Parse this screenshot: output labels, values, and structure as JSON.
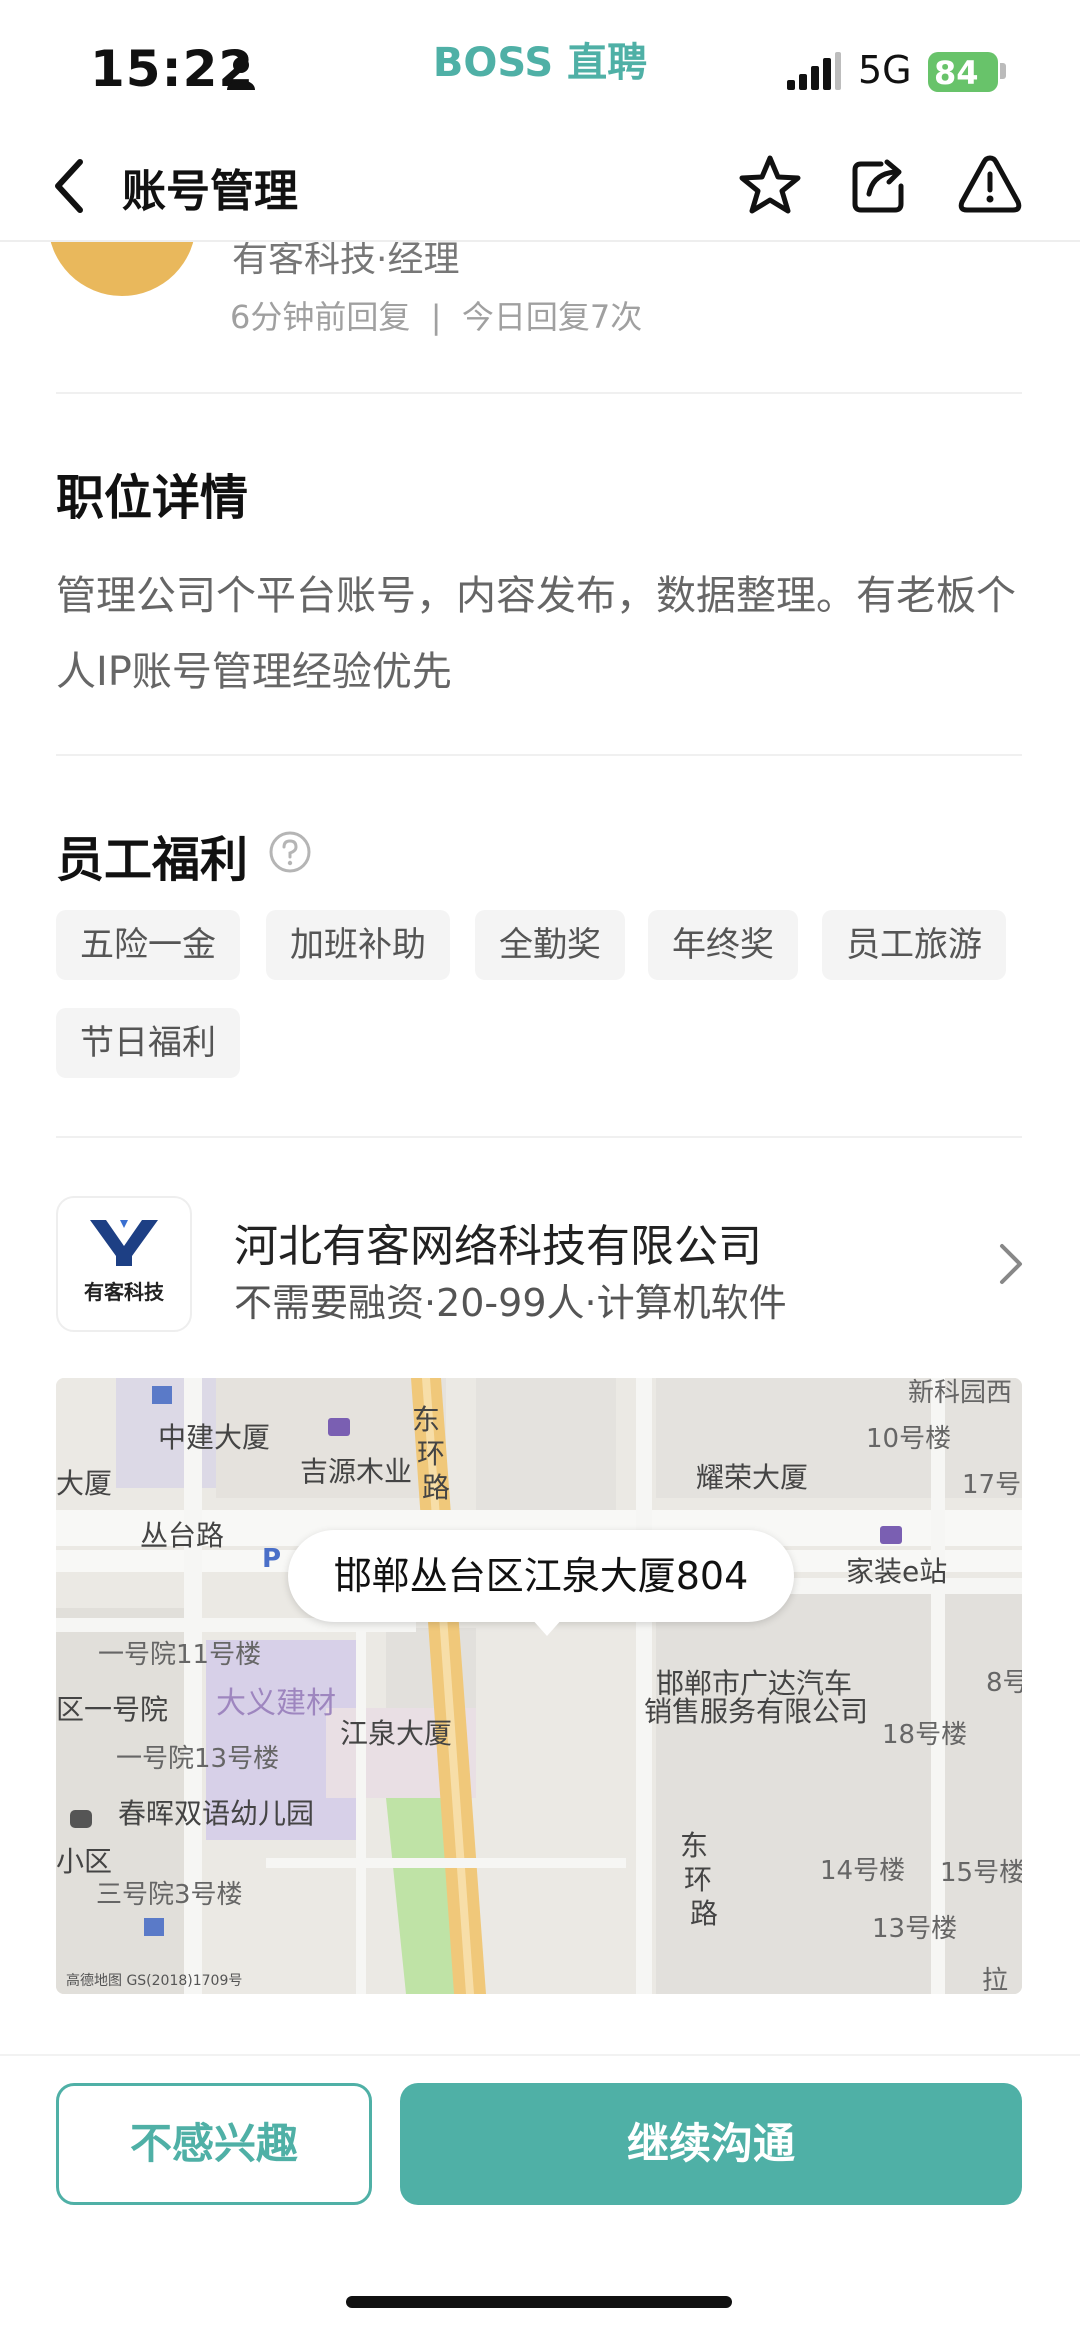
{
  "status_bar": {
    "time": "15:22",
    "app_brand": "BOSS 直聘",
    "network": "5G",
    "battery": "84"
  },
  "nav": {
    "title": "账号管理",
    "icons": [
      "back-icon",
      "star-icon",
      "share-icon",
      "warning-icon"
    ]
  },
  "recruiter": {
    "title": "有客科技·经理",
    "reply_info": "6分钟前回复  |  今日回复7次"
  },
  "job_details": {
    "heading": "职位详情",
    "description": "管理公司个平台账号，内容发布，数据整理。有老板个人IP账号管理经验优先"
  },
  "benefits": {
    "heading": "员工福利",
    "items": [
      "五险一金",
      "加班补助",
      "全勤奖",
      "年终奖",
      "员工旅游",
      "节日福利"
    ]
  },
  "company": {
    "logo_text": "有客科技",
    "name": "河北有客网络科技有限公司",
    "meta": "不需要融资·20-99人·计算机软件"
  },
  "map": {
    "address": "邯郸丛台区江泉大厦804",
    "labels": {
      "zhongjian": "中建大厦",
      "jiyuan": "吉源木业",
      "dong1": "东",
      "huan1": "环",
      "lu1": "路",
      "yaorong": "耀荣大厦",
      "xinke": "新科园西",
      "lou10": "10号楼",
      "lou17": "17号",
      "jiazhuang": "家装e站",
      "dasha_left": "大厦",
      "congtai": "丛台路",
      "p": "P",
      "yihaoyuan11": "一号院11号楼",
      "dayi": "大义建材",
      "jiangquan": "江泉大厦",
      "guangda1": "邯郸市广达汽车",
      "guangda2": "销售服务有限公司",
      "lou8": "8号",
      "qu_yihaoyuan": "区一号院",
      "yihaoyuan13": "一号院13号楼",
      "lou18": "18号楼",
      "chunhui": "春晖双语幼儿园",
      "dong2": "东",
      "huan2": "环",
      "lu2": "路",
      "xiaoqu": "小区",
      "sanhaoyuan3": "三号院3号楼",
      "lou14": "14号楼",
      "lou15": "15号楼",
      "lou13": "13号楼",
      "bottom_right": "拉",
      "attribution": "高德地图 GS(2018)1709号"
    }
  },
  "actions": {
    "not_interested": "不感兴趣",
    "continue_chat": "继续沟通"
  },
  "colors": {
    "accent": "#4fb0a6",
    "battery": "#68c36a"
  }
}
